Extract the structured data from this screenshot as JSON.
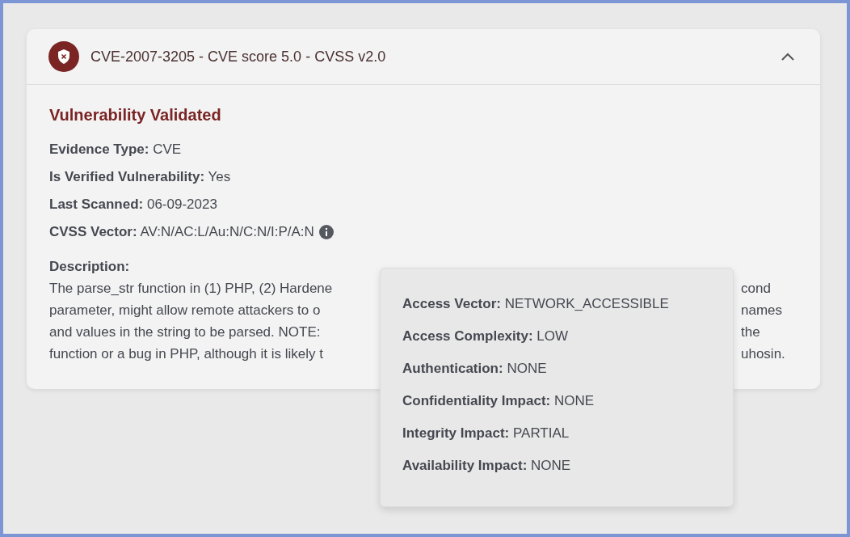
{
  "card": {
    "title": "CVE-2007-3205 - CVE score 5.0 - CVSS v2.0",
    "expanded": true,
    "status": "Vulnerability Validated",
    "fields": [
      {
        "label": "Evidence Type:",
        "value": "CVE"
      },
      {
        "label": "Is Verified Vulnerability:",
        "value": "Yes"
      },
      {
        "label": "Last Scanned:",
        "value": "06-09-2023"
      },
      {
        "label": "CVSS Vector:",
        "value": "AV:N/AC:L/Au:N/C:N/I:P/A:N",
        "info": true
      }
    ],
    "description": {
      "label": "Description:",
      "lines": [
        {
          "left": "The parse_str function in (1) PHP, (2) Hardene",
          "right": "cond"
        },
        {
          "left": "parameter, might allow remote attackers to o",
          "right": "names"
        },
        {
          "left": "and values in the string to be parsed. NOTE:",
          "right": "the"
        },
        {
          "left": "function or a bug in PHP, although it is likely t",
          "right": "uhosin."
        }
      ]
    }
  },
  "tooltip": {
    "items": [
      {
        "label": "Access Vector:",
        "value": "NETWORK_ACCESSIBLE"
      },
      {
        "label": "Access Complexity:",
        "value": "LOW"
      },
      {
        "label": "Authentication:",
        "value": "NONE"
      },
      {
        "label": "Confidentiality Impact:",
        "value": "NONE"
      },
      {
        "label": "Integrity Impact:",
        "value": "PARTIAL"
      },
      {
        "label": "Availability Impact:",
        "value": "NONE"
      }
    ]
  }
}
